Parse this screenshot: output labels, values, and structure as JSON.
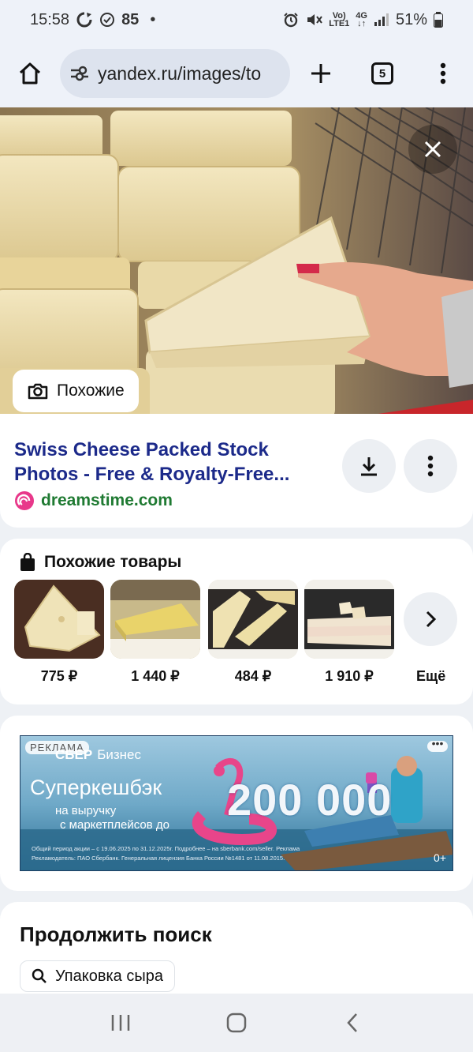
{
  "status_bar": {
    "time": "15:58",
    "notif_count": "85",
    "dot": "•",
    "volte_top": "Vo)",
    "volte_bottom": "LTE1",
    "network_top": "4G",
    "network_bottom": "↓↑",
    "battery": "51%"
  },
  "browser": {
    "url": "yandex.ru/images/to",
    "tab_count": "5"
  },
  "image_view": {
    "similar_button": "Похожие"
  },
  "result": {
    "title": "Swiss Cheese Packed Stock Photos - Free & Royalty-Free...",
    "source": "dreamstime.com"
  },
  "products": {
    "heading": "Похожие товары",
    "items": [
      {
        "price": "775 ₽"
      },
      {
        "price": "1 440 ₽"
      },
      {
        "price": "484 ₽"
      },
      {
        "price": "1 910 ₽"
      }
    ],
    "more_label": "Ещё"
  },
  "ad": {
    "badge": "РЕКЛАМА",
    "brand_name": "СБЕР",
    "brand_suffix": "Бизнес",
    "headline": "Суперкешбэк",
    "sub_line1": "на выручку",
    "sub_line2": "с маркетплейсов до",
    "amount": "200 000",
    "fine_print1": "Общий период акции – с 19.06.2025 по 31.12.2025г. Подробнее – на sberbank.com/seller. Реклама",
    "fine_print2": "Рекламодатель: ПАО Сбербанк. Генеральная лицензия Банка России №1481 от 11.08.2015.",
    "age_rating": "0+",
    "colors": {
      "sea": "#3c86ad",
      "sky": "#9cc7de",
      "flamingo": "#e8458a"
    }
  },
  "continue_search": {
    "heading": "Продолжить поиск",
    "chip": "Упаковка сыра"
  },
  "icons": [
    "home-icon",
    "site-settings-icon",
    "plus-icon",
    "tabs-icon",
    "more-vertical-icon",
    "close-icon",
    "camera-search-icon",
    "download-icon",
    "shopping-bag-icon",
    "chevron-right-icon",
    "search-icon",
    "recent-apps-icon",
    "home-nav-icon",
    "back-icon"
  ]
}
